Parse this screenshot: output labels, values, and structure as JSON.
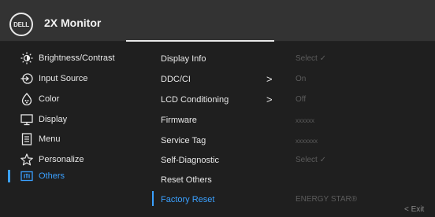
{
  "header": {
    "logo_text": "DELL",
    "title": "2X Monitor"
  },
  "menu": [
    {
      "label": "Brightness/Contrast",
      "icon": "brightness-icon"
    },
    {
      "label": "Input Source",
      "icon": "input-source-icon"
    },
    {
      "label": "Color",
      "icon": "color-icon"
    },
    {
      "label": "Display",
      "icon": "display-icon"
    },
    {
      "label": "Menu",
      "icon": "menu-icon"
    },
    {
      "label": "Personalize",
      "icon": "star-icon"
    },
    {
      "label": "Others",
      "icon": "others-icon",
      "selected": true
    }
  ],
  "submenu": [
    {
      "label": "Display Info",
      "value": "Select ✓"
    },
    {
      "label": "DDC/CI",
      "arrow": ">",
      "value": "On"
    },
    {
      "label": "LCD Conditioning",
      "arrow": ">",
      "value": "Off"
    },
    {
      "label": "Firmware",
      "value": "xxxxxx"
    },
    {
      "label": "Service Tag",
      "value": "xxxxxxx"
    },
    {
      "label": "Self-Diagnostic",
      "value": "Select ✓"
    },
    {
      "label": "Reset Others",
      "value": ""
    },
    {
      "label": "Factory Reset",
      "value": "ENERGY STAR®",
      "selected": true
    }
  ],
  "exit_label": "< Exit",
  "colors": {
    "accent": "#3aa0ff",
    "header_bg": "#333333",
    "body_bg": "#1f1f1f",
    "muted": "#5c5c5c"
  }
}
